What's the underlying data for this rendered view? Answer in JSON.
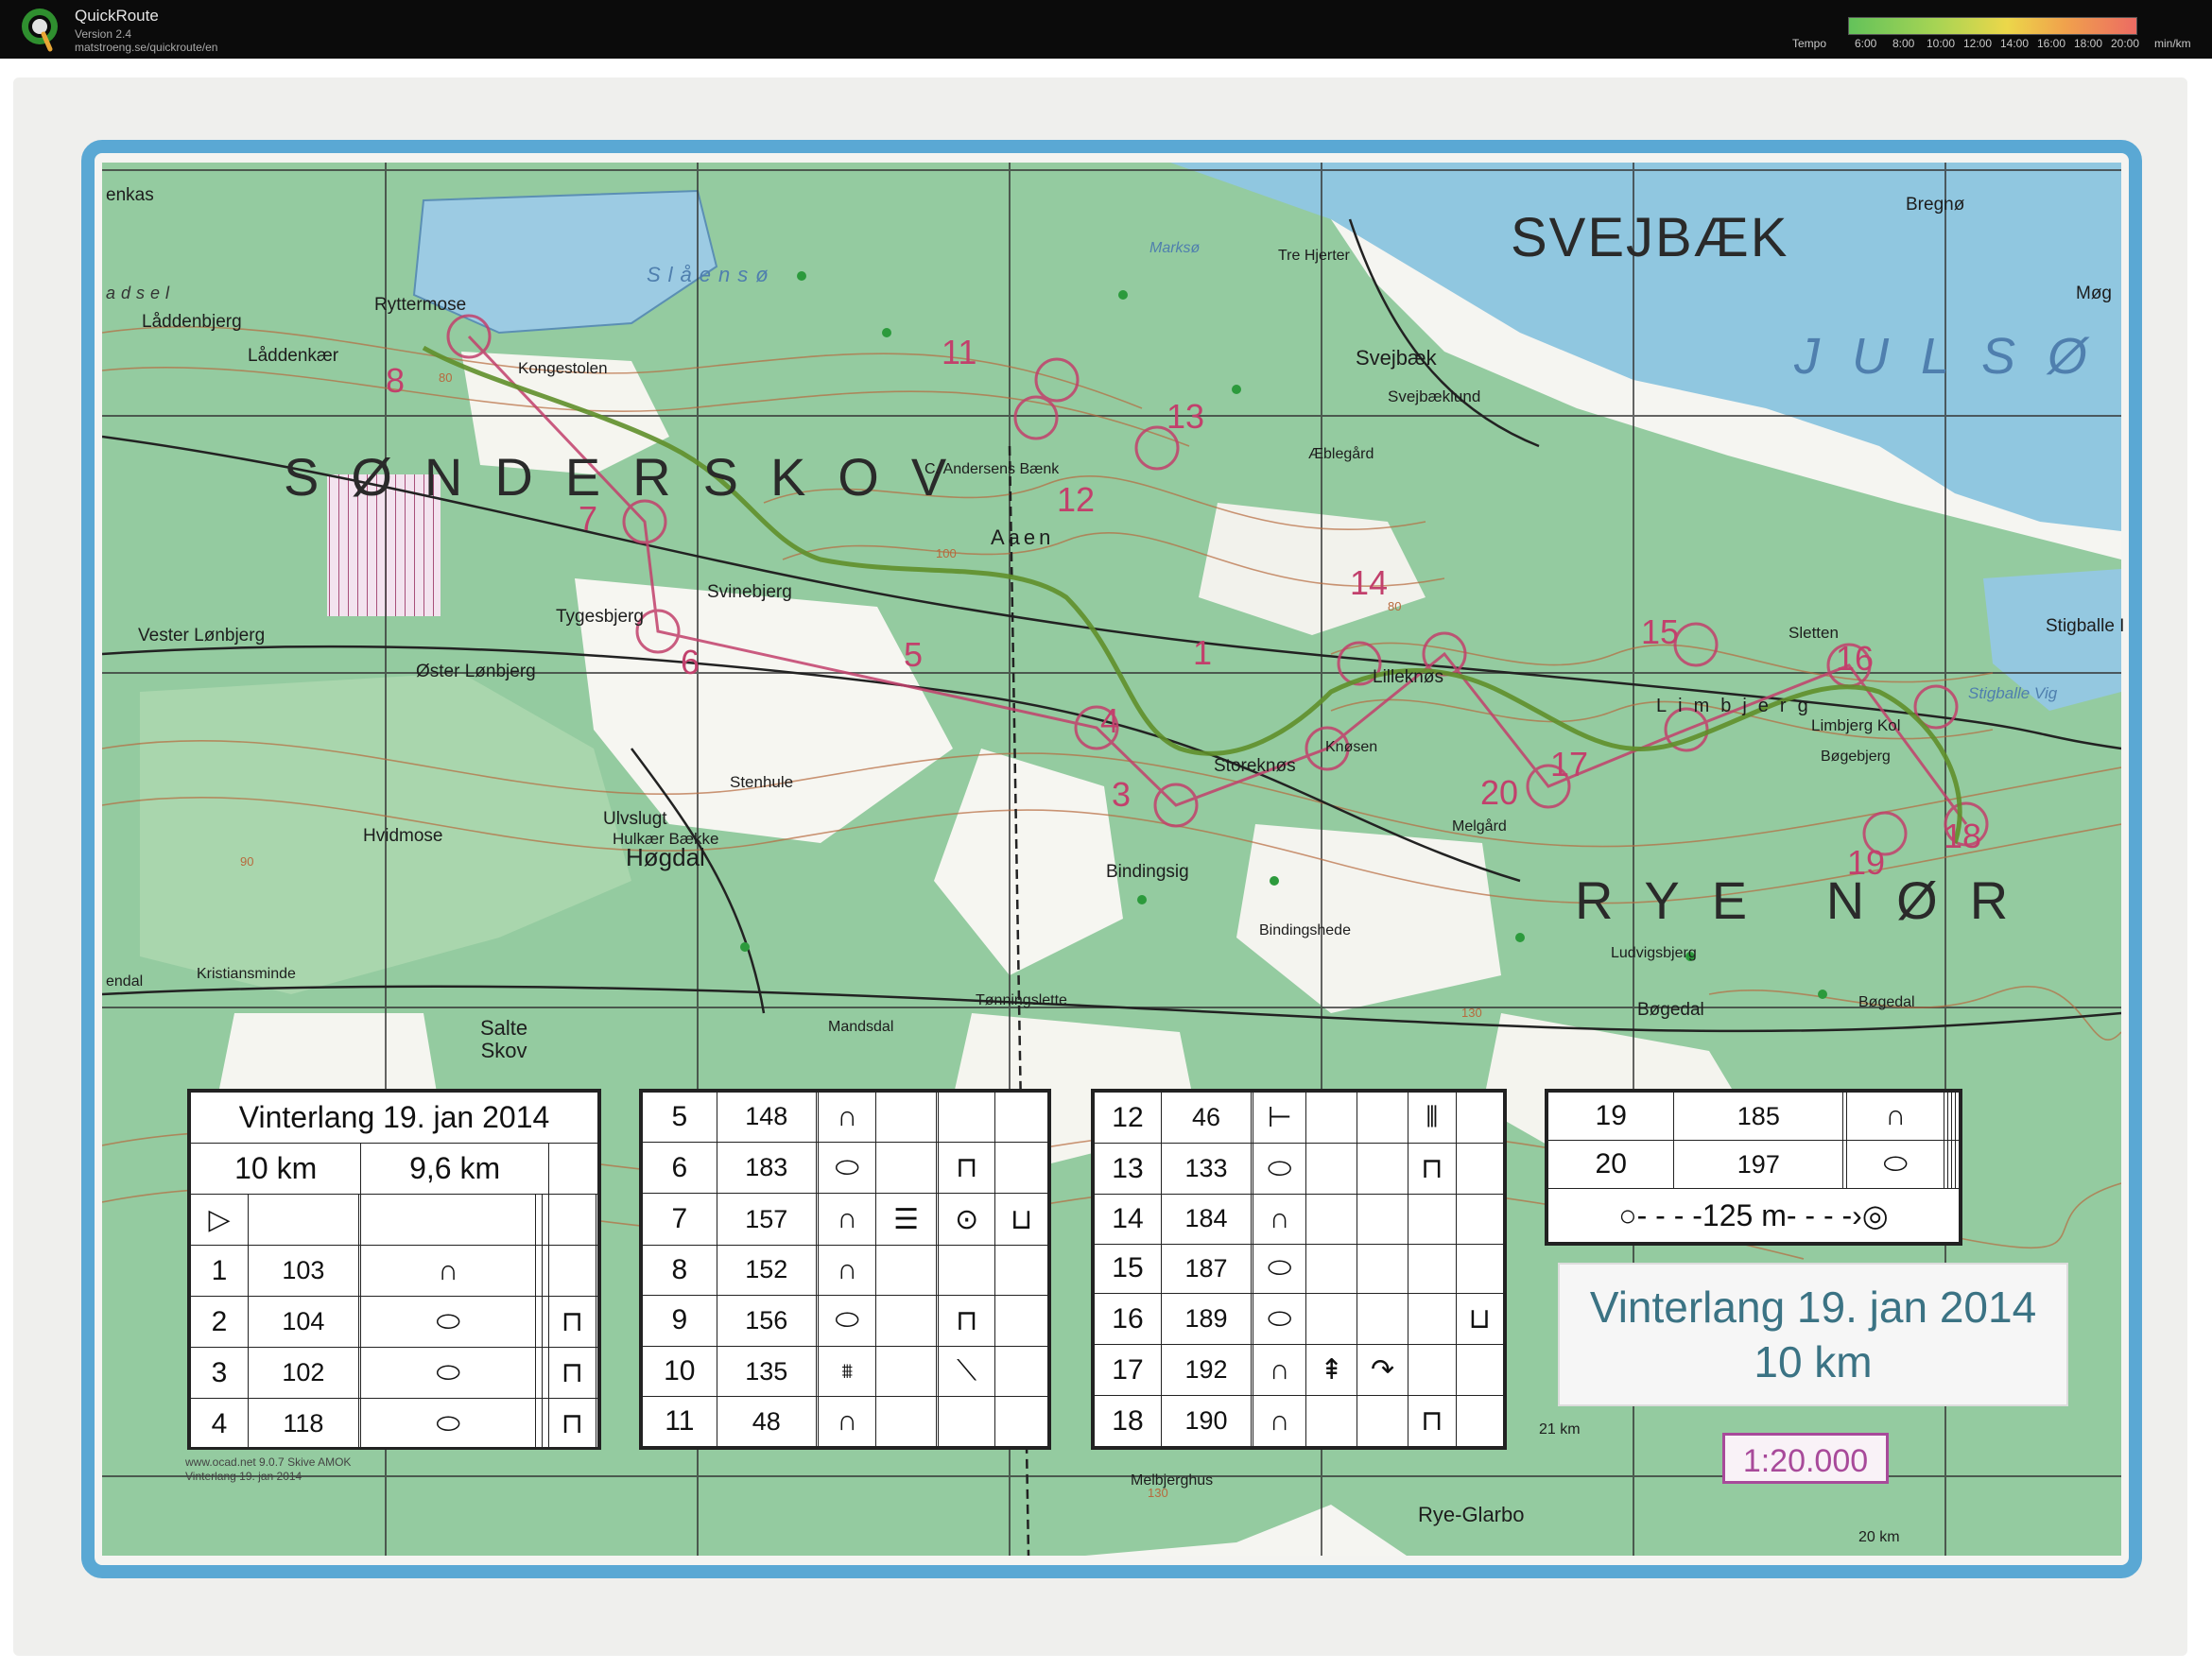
{
  "header": {
    "app_title": "QuickRoute",
    "version": "Version 2.4",
    "url": "matstroeng.se/quickroute/en",
    "tempo_label": "Tempo",
    "tempo_ticks": [
      "6:00",
      "8:00",
      "10:00",
      "12:00",
      "14:00",
      "16:00",
      "18:00",
      "20:00"
    ],
    "tempo_unit": "min/km"
  },
  "map": {
    "areas": {
      "sonderskov": "SØNDERSKOV",
      "svejbaek_big": "SVEJBÆK",
      "rye_nor": "RYE NØR"
    },
    "water": {
      "julso": "JULSØ",
      "slaenso": "Slåensø",
      "marksø": "Marksø",
      "stigballe_vig": "Stigballe Vig",
      "hadsel": "adsel"
    },
    "places": {
      "enkas": "enkas",
      "laddenbjerg": "Låddenbjerg",
      "laddenkaer": "Låddenkær",
      "ryttermose": "Ryttermose",
      "kongestolen": "Kongestolen",
      "tre_hjerter": "Tre Hjerter",
      "bregno": "Bregnø",
      "mog": "Møg",
      "svejbaek": "Svejbæk",
      "svejbaeklund": "Svejbæklund",
      "aebleard": "Æblegård",
      "c_andersens_baenk": "C. Andersens Bænk",
      "aaen": "Aaen",
      "svinebjerg": "Svinebjerg",
      "tygesbjerg": "Tygesbjerg",
      "vester_lonbjerg": "Vester Lønbjerg",
      "oster_lonbjerg": "Øster Lønbjerg",
      "lillekns": "Lilleknøs",
      "sletten": "Sletten",
      "stigballe": "Stigballe I",
      "limbjerg": "Limbjerg",
      "limbjerg_kol": "Limbjerg Kol",
      "bogebjerg": "Bøgebjerg",
      "storeknos": "Storeknøs",
      "knosen": "Knøsen",
      "melgard": "Melgård",
      "stenhule": "Stenhule",
      "ulvslugt": "Ulvslugt",
      "hulkaer_baekke": "Hulkær Bække",
      "hogdal": "Høgdal",
      "hvidmose": "Hvidmose",
      "bindingsig": "Bindingsig",
      "bindingshede": "Bindingshede",
      "ludvigsbjerg": "Ludvigsbjerg",
      "kristiansminde": "Kristiansminde",
      "endal": "endal",
      "salte_skov": "Salte\nSkov",
      "mandsdal": "Mandsdal",
      "tonningslette": "Tønningslette",
      "bogedal_1": "Bøgedal",
      "bogedal_2": "Bøgedal",
      "rye_glarbo": "Rye-Glarbo",
      "melbjerghus": "Melbjerghus",
      "km21": "21 km",
      "km20": "20 km",
      "h80": "80",
      "h90": "90",
      "h130": "130",
      "h130b": "130",
      "h100": "100",
      "h80b": "80"
    },
    "control_numbers": {
      "c8": "8",
      "c11": "11",
      "c13": "13",
      "c12": "12",
      "c7": "7",
      "c6": "6",
      "c5": "5",
      "c14": "14",
      "c4": "4",
      "c3": "3",
      "c1": "1",
      "c20": "20",
      "c16": "16",
      "c15": "15",
      "c17": "17",
      "c18": "18",
      "c19": "19"
    }
  },
  "descriptions": {
    "title": "Vinterlang 19. jan 2014",
    "dist_a": "10 km",
    "dist_b": "9,6 km",
    "table1": [
      {
        "n": "1",
        "c": "103"
      },
      {
        "n": "2",
        "c": "104"
      },
      {
        "n": "3",
        "c": "102"
      },
      {
        "n": "4",
        "c": "118"
      }
    ],
    "table2": [
      {
        "n": "5",
        "c": "148"
      },
      {
        "n": "6",
        "c": "183"
      },
      {
        "n": "7",
        "c": "157"
      },
      {
        "n": "8",
        "c": "152"
      },
      {
        "n": "9",
        "c": "156"
      },
      {
        "n": "10",
        "c": "135"
      },
      {
        "n": "11",
        "c": "48"
      }
    ],
    "table3": [
      {
        "n": "12",
        "c": "46"
      },
      {
        "n": "13",
        "c": "133"
      },
      {
        "n": "14",
        "c": "184"
      },
      {
        "n": "15",
        "c": "187"
      },
      {
        "n": "16",
        "c": "189"
      },
      {
        "n": "17",
        "c": "192"
      },
      {
        "n": "18",
        "c": "190"
      }
    ],
    "table4": [
      {
        "n": "19",
        "c": "185"
      },
      {
        "n": "20",
        "c": "197"
      }
    ],
    "finish_distance": "125 m"
  },
  "info_box": {
    "title": "Vinterlang 19. jan 2014",
    "distance": "10 km"
  },
  "scale": "1:20.000",
  "credit": {
    "line1": "www.ocad.net  9.0.7 Skive AMOK",
    "line2": "Vinterlang 19. jan 2014"
  },
  "colors": {
    "forest": "#8fc79a",
    "open": "#f6f6f2",
    "water": "#8ec6df",
    "contour": "#b76a3e",
    "course": "#c2406c",
    "route": "#5f8f2a",
    "frame": "#5aa8d4"
  }
}
